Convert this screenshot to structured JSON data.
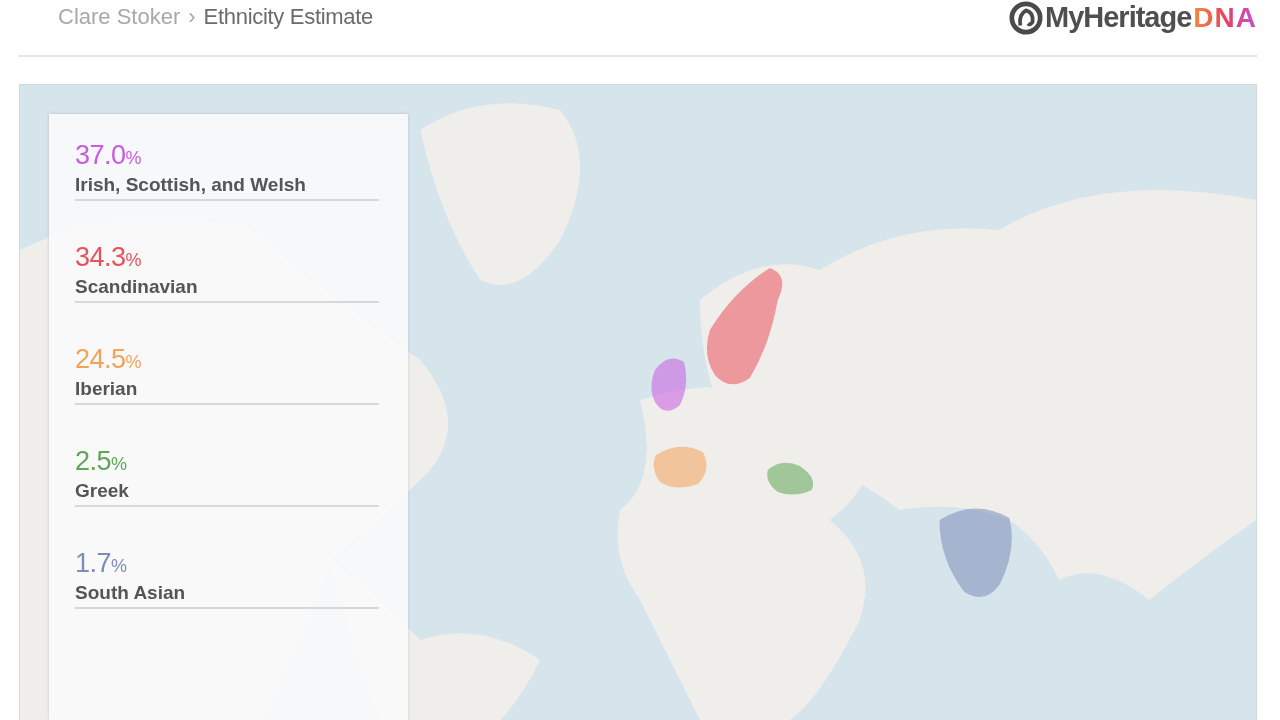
{
  "breadcrumb": {
    "parent": "Clare Stoker",
    "separator": "›",
    "title": "Ethnicity Estimate"
  },
  "logo": {
    "brand": "MyHeritage",
    "suffix": "DNA"
  },
  "ethnicities": [
    {
      "percent": "37.0",
      "unit": "%",
      "name": "Irish, Scottish, and Welsh",
      "color": "#c95be0"
    },
    {
      "percent": "34.3",
      "unit": "%",
      "name": "Scandinavian",
      "color": "#e9525c"
    },
    {
      "percent": "24.5",
      "unit": "%",
      "name": "Iberian",
      "color": "#f3a25a"
    },
    {
      "percent": "2.5",
      "unit": "%",
      "name": "Greek",
      "color": "#5fa655"
    },
    {
      "percent": "1.7",
      "unit": "%",
      "name": "South Asian",
      "color": "#7d8db8"
    }
  ]
}
